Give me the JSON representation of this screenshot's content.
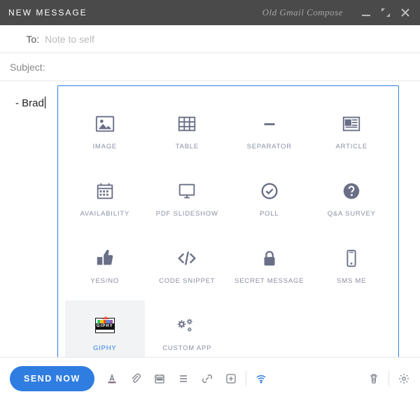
{
  "header": {
    "title": "NEW MESSAGE",
    "old_compose": "Old Gmail Compose"
  },
  "fields": {
    "to_label": "To:",
    "to_placeholder": "Note to self",
    "subject_label": "Subject:"
  },
  "body": {
    "signature": "- Brad"
  },
  "insert_menu": {
    "items": [
      {
        "id": "image",
        "label": "IMAGE"
      },
      {
        "id": "table",
        "label": "TABLE"
      },
      {
        "id": "separator",
        "label": "SEPARATOR"
      },
      {
        "id": "article",
        "label": "ARTICLE"
      },
      {
        "id": "availability",
        "label": "AVAILABILITY"
      },
      {
        "id": "pdf-slideshow",
        "label": "PDF SLIDESHOW"
      },
      {
        "id": "poll",
        "label": "POLL"
      },
      {
        "id": "qa-survey",
        "label": "Q&A SURVEY"
      },
      {
        "id": "yesno",
        "label": "YES/NO"
      },
      {
        "id": "code-snippet",
        "label": "CODE SNIPPET"
      },
      {
        "id": "secret-message",
        "label": "SECRET MESSAGE"
      },
      {
        "id": "sms-me",
        "label": "SMS ME"
      },
      {
        "id": "giphy",
        "label": "GIPHY",
        "selected": true
      },
      {
        "id": "custom-app",
        "label": "CUSTOM APP"
      }
    ]
  },
  "toolbar": {
    "send_label": "SEND NOW"
  }
}
